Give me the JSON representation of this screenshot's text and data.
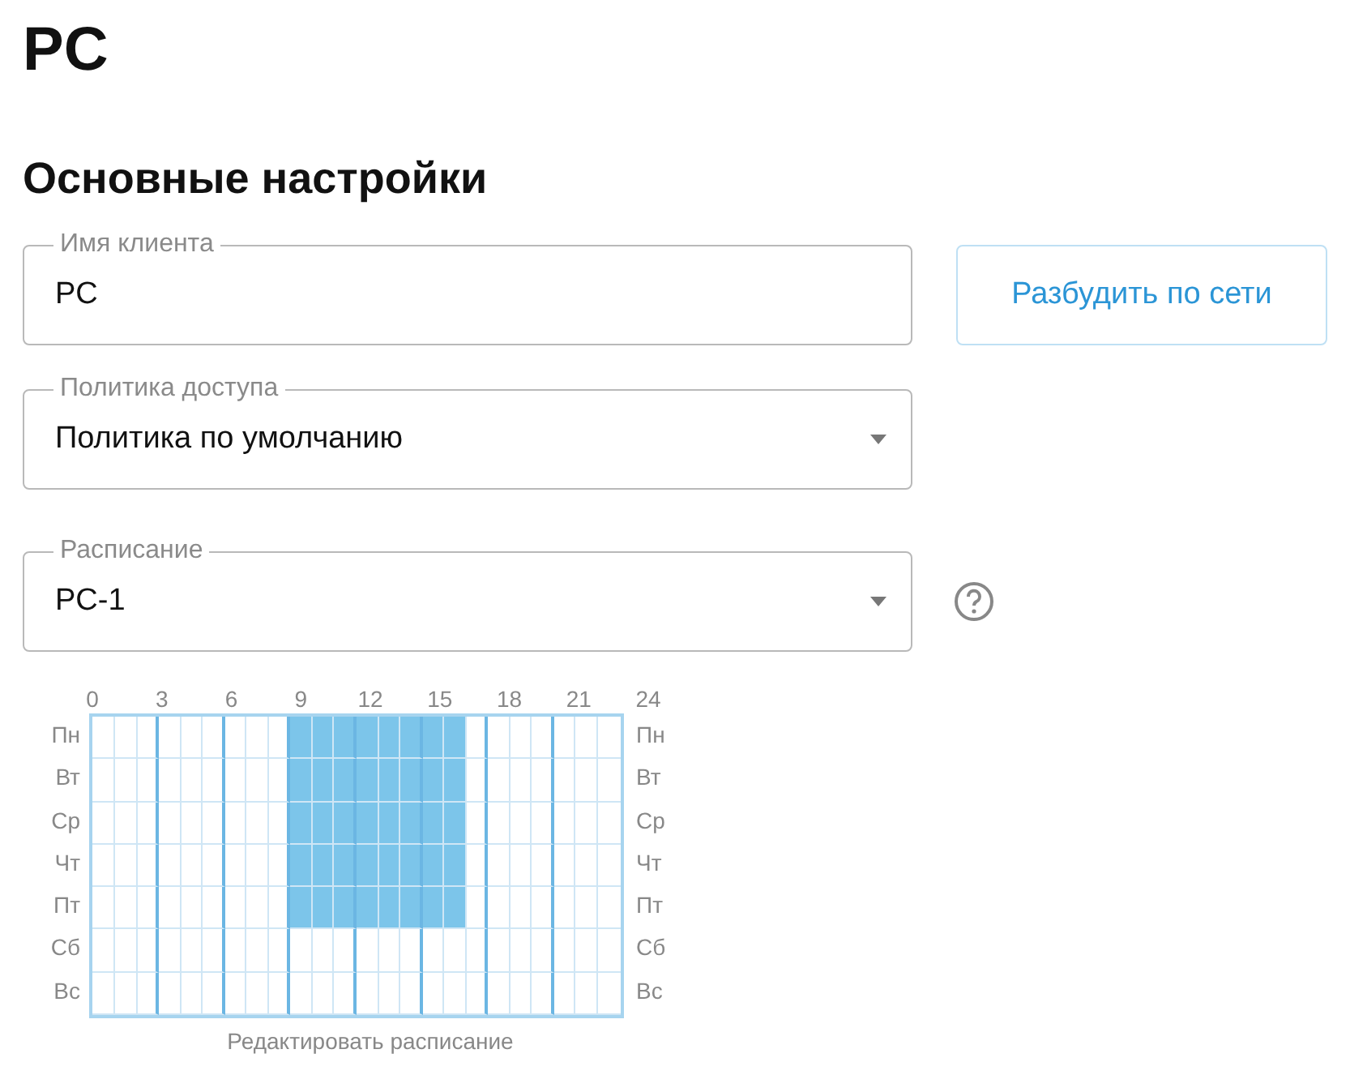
{
  "title": "PC",
  "section": "Основные настройки",
  "fields": [
    {
      "kind": "text",
      "label": "Имя клиента",
      "value": "PC"
    },
    {
      "kind": "select",
      "label": "Политика доступа",
      "value": "Политика по умолчанию"
    },
    {
      "kind": "select",
      "label": "Расписание",
      "value": "PC-1"
    }
  ],
  "wake_button": "Разбудить по сети",
  "schedule": {
    "hour_labels": [
      "0",
      "3",
      "6",
      "9",
      "12",
      "15",
      "18",
      "21",
      "24"
    ],
    "days": [
      {
        "label_left": "Пн",
        "label_right": "Пн",
        "hours": [
          false,
          false,
          false,
          false,
          false,
          false,
          false,
          false,
          false,
          true,
          true,
          true,
          true,
          true,
          true,
          true,
          true,
          false,
          false,
          false,
          false,
          false,
          false,
          false
        ]
      },
      {
        "label_left": "Вт",
        "label_right": "Вт",
        "hours": [
          false,
          false,
          false,
          false,
          false,
          false,
          false,
          false,
          false,
          true,
          true,
          true,
          true,
          true,
          true,
          true,
          true,
          false,
          false,
          false,
          false,
          false,
          false,
          false
        ]
      },
      {
        "label_left": "Ср",
        "label_right": "Ср",
        "hours": [
          false,
          false,
          false,
          false,
          false,
          false,
          false,
          false,
          false,
          true,
          true,
          true,
          true,
          true,
          true,
          true,
          true,
          false,
          false,
          false,
          false,
          false,
          false,
          false
        ]
      },
      {
        "label_left": "Чт",
        "label_right": "Чт",
        "hours": [
          false,
          false,
          false,
          false,
          false,
          false,
          false,
          false,
          false,
          true,
          true,
          true,
          true,
          true,
          true,
          true,
          true,
          false,
          false,
          false,
          false,
          false,
          false,
          false
        ]
      },
      {
        "label_left": "Пт",
        "label_right": "Пт",
        "hours": [
          false,
          false,
          false,
          false,
          false,
          false,
          false,
          false,
          false,
          true,
          true,
          true,
          true,
          true,
          true,
          true,
          true,
          false,
          false,
          false,
          false,
          false,
          false,
          false
        ]
      },
      {
        "label_left": "Сб",
        "label_right": "Сб",
        "hours": [
          false,
          false,
          false,
          false,
          false,
          false,
          false,
          false,
          false,
          false,
          false,
          false,
          false,
          false,
          false,
          false,
          false,
          false,
          false,
          false,
          false,
          false,
          false,
          false
        ]
      },
      {
        "label_left": "Вс",
        "label_right": "Вс",
        "hours": [
          false,
          false,
          false,
          false,
          false,
          false,
          false,
          false,
          false,
          false,
          false,
          false,
          false,
          false,
          false,
          false,
          false,
          false,
          false,
          false,
          false,
          false,
          false,
          false
        ]
      }
    ],
    "edit_link": "Редактировать расписание"
  }
}
